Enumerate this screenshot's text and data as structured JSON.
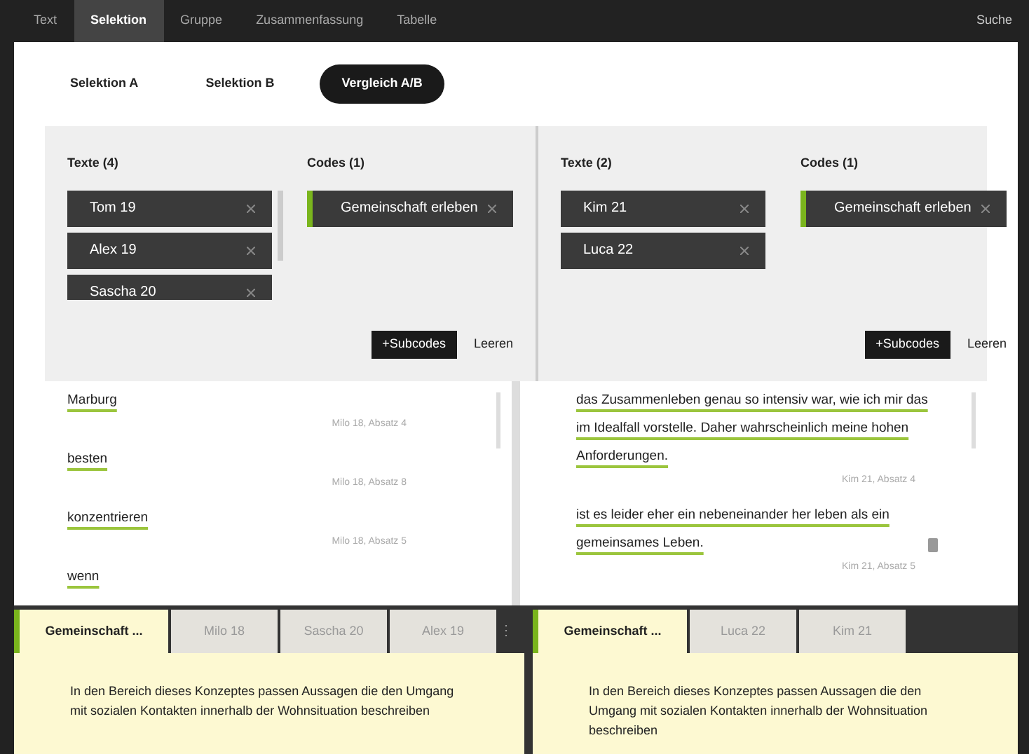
{
  "nav": {
    "tabs": [
      {
        "label": "Text",
        "selected": false
      },
      {
        "label": "Selektion",
        "selected": true
      },
      {
        "label": "Gruppe",
        "selected": false
      },
      {
        "label": "Zusammenfassung",
        "selected": false
      },
      {
        "label": "Tabelle",
        "selected": false
      }
    ],
    "search": "Suche"
  },
  "subtabs": [
    {
      "label": "Selektion A",
      "selected": false
    },
    {
      "label": "Selektion B",
      "selected": false
    },
    {
      "label": "Vergleich A/B",
      "selected": true
    }
  ],
  "panels": [
    {
      "texts_title": "Texte (4)",
      "texts": [
        "Tom 19",
        "Alex 19",
        "Sascha 20"
      ],
      "codes_title": "Codes (1)",
      "codes": [
        "Gemeinschaft erleben"
      ],
      "subcodes": "+Subcodes",
      "clear": "Leeren",
      "results": [
        {
          "text": "Marburg",
          "meta": "Milo 18, Absatz 4",
          "trash": false
        },
        {
          "text": "besten",
          "meta": "Milo 18, Absatz 8",
          "trash": false
        },
        {
          "text": "konzentrieren",
          "meta": "Milo 18, Absatz 5",
          "trash": false
        },
        {
          "text": "wenn",
          "trash": false
        }
      ],
      "tabs": [
        {
          "label": "Gemeinschaft ...",
          "selected": true
        },
        {
          "label": "Milo 18",
          "selected": false
        },
        {
          "label": "Sascha 20",
          "selected": false
        },
        {
          "label": "Alex 19",
          "selected": false
        }
      ],
      "more": "⋮",
      "description": "In den Bereich dieses Konzeptes passen Aussagen die den Umgang mit sozialen Kontakten innerhalb der Wohnsituation beschreiben"
    },
    {
      "texts_title": "Texte (2)",
      "texts": [
        "Kim 21",
        "Luca 22"
      ],
      "codes_title": "Codes (1)",
      "codes": [
        "Gemeinschaft erleben"
      ],
      "subcodes": "+Subcodes",
      "clear": "Leeren",
      "results": [
        {
          "text": "das Zusammenleben genau so intensiv war, wie ich mir das im Idealfall vorstelle. Daher wahrscheinlich meine hohen Anforderungen.",
          "meta": "Kim 21, Absatz 4",
          "trash": false
        },
        {
          "text": "ist es leider eher ein nebeneinander her leben als ein gemeinsames Leben.",
          "meta": "Kim 21, Absatz 5",
          "trash": true
        }
      ],
      "tabs": [
        {
          "label": "Gemeinschaft ...",
          "selected": true
        },
        {
          "label": "Luca 22",
          "selected": false
        },
        {
          "label": "Kim 21",
          "selected": false
        }
      ],
      "description": "In den Bereich dieses Konzeptes passen Aussagen die den Umgang mit sozialen Kontakten innerhalb der Wohnsituation beschreiben"
    }
  ]
}
